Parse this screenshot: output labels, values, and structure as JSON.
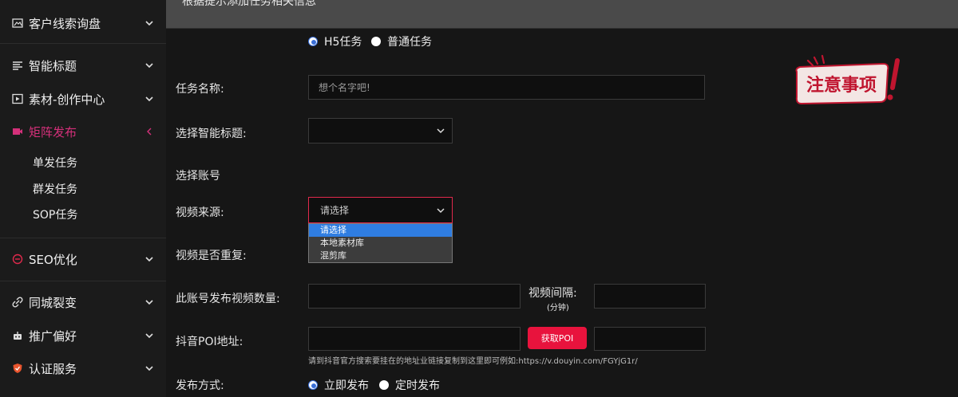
{
  "sidebar": {
    "items": [
      {
        "label": "客户线索询盘",
        "icon": "image-icon"
      },
      {
        "label": "智能标题",
        "icon": "list-icon"
      },
      {
        "label": "素材-创作中心",
        "icon": "video-icon"
      },
      {
        "label": "矩阵发布",
        "icon": "camera-icon"
      },
      {
        "label": "SEO优化",
        "icon": "seo-icon"
      },
      {
        "label": "同城裂变",
        "icon": "link-icon"
      },
      {
        "label": "推广偏好",
        "icon": "robot-icon"
      },
      {
        "label": "认证服务",
        "icon": "shield-icon"
      }
    ],
    "sub_items": [
      "单发任务",
      "群发任务",
      "SOP任务"
    ],
    "active_color": "#d4307a"
  },
  "topbar": {
    "text": "根据提示添加任务相关信息"
  },
  "form": {
    "task_type": {
      "options": [
        "H5任务",
        "普通任务"
      ],
      "selected": "H5任务"
    },
    "task_name": {
      "label": "任务名称:",
      "placeholder": "想个名字吧!"
    },
    "smart_title": {
      "label": "选择智能标题:"
    },
    "account": {
      "label": "选择账号"
    },
    "video_source": {
      "label": "视频来源:",
      "value": "请选择",
      "options": [
        "请选择",
        "本地素材库",
        "混剪库"
      ]
    },
    "video_repeat": {
      "label": "视频是否重复:"
    },
    "video_count": {
      "label": "此账号发布视频数量:"
    },
    "video_interval": {
      "label": "视频间隔:",
      "unit": "(分钟)"
    },
    "poi": {
      "label": "抖音POI地址:",
      "button": "获取POI",
      "hint": "请到抖音官方搜索要挂在的地址业链接复制到这里即可例如:https://v.douyin.com/FGYjG1r/"
    },
    "publish_mode": {
      "label": "发布方式:",
      "options": [
        "立即发布",
        "定时发布"
      ],
      "selected": "立即发布"
    }
  },
  "notice": {
    "text": "注意事项",
    "color": "#c0152f"
  },
  "colors": {
    "accent_blue": "#2f7de1",
    "button_red": "#e8133d"
  }
}
